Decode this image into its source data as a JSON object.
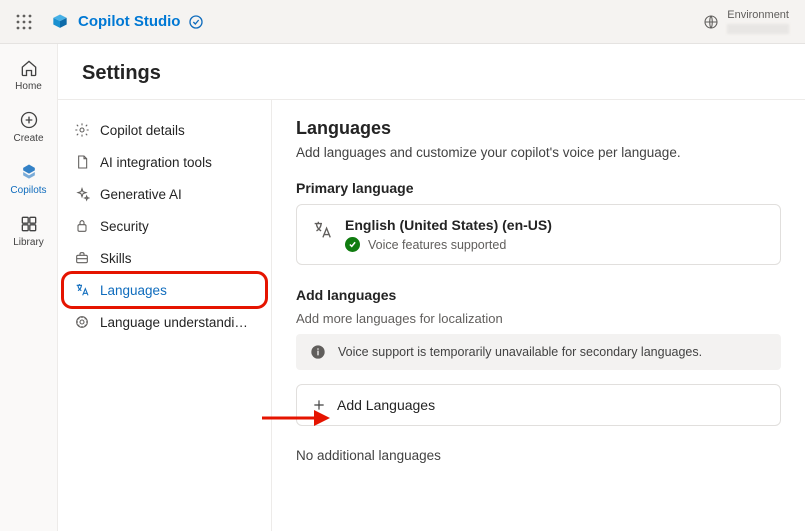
{
  "header": {
    "product_name": "Copilot Studio",
    "env_label": "Environment"
  },
  "rail": {
    "items": [
      {
        "id": "home",
        "label": "Home"
      },
      {
        "id": "create",
        "label": "Create"
      },
      {
        "id": "copilots",
        "label": "Copilots"
      },
      {
        "id": "library",
        "label": "Library"
      }
    ]
  },
  "page": {
    "title": "Settings"
  },
  "settings_nav": {
    "items": [
      {
        "id": "details",
        "label": "Copilot details"
      },
      {
        "id": "ai-tools",
        "label": "AI integration tools"
      },
      {
        "id": "gen-ai",
        "label": "Generative AI"
      },
      {
        "id": "security",
        "label": "Security"
      },
      {
        "id": "skills",
        "label": "Skills"
      },
      {
        "id": "languages",
        "label": "Languages"
      },
      {
        "id": "lu",
        "label": "Language understandi…"
      }
    ]
  },
  "content": {
    "heading": "Languages",
    "subheading": "Add languages and customize your copilot's voice per language.",
    "primary_section_label": "Primary language",
    "primary_language": {
      "name": "English (United States) (en-US)",
      "voice_support_text": "Voice features supported"
    },
    "add_section_label": "Add languages",
    "add_section_help": "Add more languages for localization",
    "info_banner": "Voice support is temporarily unavailable for secondary languages.",
    "add_button_label": "Add Languages",
    "empty_state": "No additional languages"
  },
  "colors": {
    "accent": "#0f6cbd",
    "annotation": "#e51400",
    "success": "#107c10"
  }
}
